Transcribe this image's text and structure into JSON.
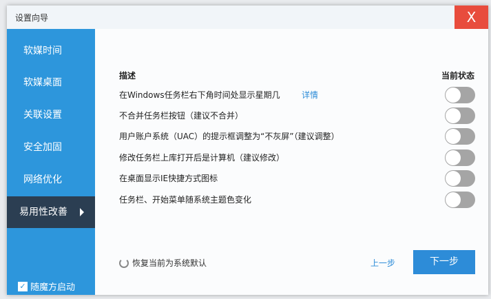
{
  "window": {
    "title": "设置向导",
    "close": "X"
  },
  "sidebar": {
    "items": [
      {
        "label": "软媒时间"
      },
      {
        "label": "软媒桌面"
      },
      {
        "label": "关联设置"
      },
      {
        "label": "安全加固"
      },
      {
        "label": "网络优化"
      },
      {
        "label": "易用性改善",
        "active": true
      }
    ],
    "autostart": {
      "label": "随魔方启动",
      "checked": true
    }
  },
  "table": {
    "col_desc": "描述",
    "col_state": "当前状态",
    "rows": [
      {
        "text": "在Windows任务栏右下角时间处显示星期几",
        "link": "详情",
        "on": false
      },
      {
        "text": "不合并任务栏按钮（建议不合并）",
        "on": false
      },
      {
        "text": "用户账户系统（UAC）的提示框调整为“不灰屏”（建议调整）",
        "on": false
      },
      {
        "text": "修改任务栏上库打开后是计算机（建议修改）",
        "on": false
      },
      {
        "text": "在桌面显示IE快捷方式图标",
        "on": false
      },
      {
        "text": "任务栏、开始菜单随系统主题色变化",
        "on": false
      }
    ]
  },
  "footer": {
    "restore": "恢复当前为系统默认",
    "prev": "上一步",
    "next": "下一步"
  }
}
